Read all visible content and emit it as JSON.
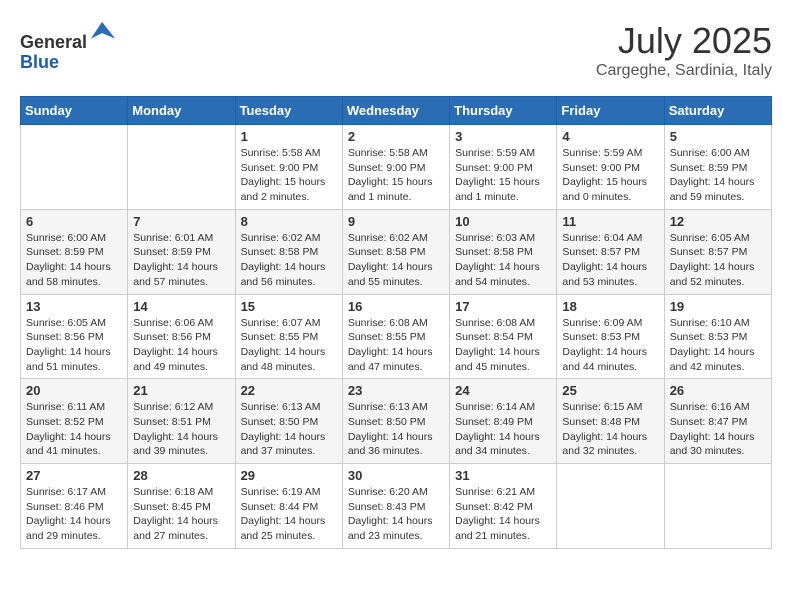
{
  "header": {
    "logo_general": "General",
    "logo_blue": "Blue",
    "month": "July 2025",
    "location": "Cargeghe, Sardinia, Italy"
  },
  "weekdays": [
    "Sunday",
    "Monday",
    "Tuesday",
    "Wednesday",
    "Thursday",
    "Friday",
    "Saturday"
  ],
  "weeks": [
    [
      {
        "day": "",
        "info": ""
      },
      {
        "day": "",
        "info": ""
      },
      {
        "day": "1",
        "info": "Sunrise: 5:58 AM\nSunset: 9:00 PM\nDaylight: 15 hours\nand 2 minutes."
      },
      {
        "day": "2",
        "info": "Sunrise: 5:58 AM\nSunset: 9:00 PM\nDaylight: 15 hours\nand 1 minute."
      },
      {
        "day": "3",
        "info": "Sunrise: 5:59 AM\nSunset: 9:00 PM\nDaylight: 15 hours\nand 1 minute."
      },
      {
        "day": "4",
        "info": "Sunrise: 5:59 AM\nSunset: 9:00 PM\nDaylight: 15 hours\nand 0 minutes."
      },
      {
        "day": "5",
        "info": "Sunrise: 6:00 AM\nSunset: 8:59 PM\nDaylight: 14 hours\nand 59 minutes."
      }
    ],
    [
      {
        "day": "6",
        "info": "Sunrise: 6:00 AM\nSunset: 8:59 PM\nDaylight: 14 hours\nand 58 minutes."
      },
      {
        "day": "7",
        "info": "Sunrise: 6:01 AM\nSunset: 8:59 PM\nDaylight: 14 hours\nand 57 minutes."
      },
      {
        "day": "8",
        "info": "Sunrise: 6:02 AM\nSunset: 8:58 PM\nDaylight: 14 hours\nand 56 minutes."
      },
      {
        "day": "9",
        "info": "Sunrise: 6:02 AM\nSunset: 8:58 PM\nDaylight: 14 hours\nand 55 minutes."
      },
      {
        "day": "10",
        "info": "Sunrise: 6:03 AM\nSunset: 8:58 PM\nDaylight: 14 hours\nand 54 minutes."
      },
      {
        "day": "11",
        "info": "Sunrise: 6:04 AM\nSunset: 8:57 PM\nDaylight: 14 hours\nand 53 minutes."
      },
      {
        "day": "12",
        "info": "Sunrise: 6:05 AM\nSunset: 8:57 PM\nDaylight: 14 hours\nand 52 minutes."
      }
    ],
    [
      {
        "day": "13",
        "info": "Sunrise: 6:05 AM\nSunset: 8:56 PM\nDaylight: 14 hours\nand 51 minutes."
      },
      {
        "day": "14",
        "info": "Sunrise: 6:06 AM\nSunset: 8:56 PM\nDaylight: 14 hours\nand 49 minutes."
      },
      {
        "day": "15",
        "info": "Sunrise: 6:07 AM\nSunset: 8:55 PM\nDaylight: 14 hours\nand 48 minutes."
      },
      {
        "day": "16",
        "info": "Sunrise: 6:08 AM\nSunset: 8:55 PM\nDaylight: 14 hours\nand 47 minutes."
      },
      {
        "day": "17",
        "info": "Sunrise: 6:08 AM\nSunset: 8:54 PM\nDaylight: 14 hours\nand 45 minutes."
      },
      {
        "day": "18",
        "info": "Sunrise: 6:09 AM\nSunset: 8:53 PM\nDaylight: 14 hours\nand 44 minutes."
      },
      {
        "day": "19",
        "info": "Sunrise: 6:10 AM\nSunset: 8:53 PM\nDaylight: 14 hours\nand 42 minutes."
      }
    ],
    [
      {
        "day": "20",
        "info": "Sunrise: 6:11 AM\nSunset: 8:52 PM\nDaylight: 14 hours\nand 41 minutes."
      },
      {
        "day": "21",
        "info": "Sunrise: 6:12 AM\nSunset: 8:51 PM\nDaylight: 14 hours\nand 39 minutes."
      },
      {
        "day": "22",
        "info": "Sunrise: 6:13 AM\nSunset: 8:50 PM\nDaylight: 14 hours\nand 37 minutes."
      },
      {
        "day": "23",
        "info": "Sunrise: 6:13 AM\nSunset: 8:50 PM\nDaylight: 14 hours\nand 36 minutes."
      },
      {
        "day": "24",
        "info": "Sunrise: 6:14 AM\nSunset: 8:49 PM\nDaylight: 14 hours\nand 34 minutes."
      },
      {
        "day": "25",
        "info": "Sunrise: 6:15 AM\nSunset: 8:48 PM\nDaylight: 14 hours\nand 32 minutes."
      },
      {
        "day": "26",
        "info": "Sunrise: 6:16 AM\nSunset: 8:47 PM\nDaylight: 14 hours\nand 30 minutes."
      }
    ],
    [
      {
        "day": "27",
        "info": "Sunrise: 6:17 AM\nSunset: 8:46 PM\nDaylight: 14 hours\nand 29 minutes."
      },
      {
        "day": "28",
        "info": "Sunrise: 6:18 AM\nSunset: 8:45 PM\nDaylight: 14 hours\nand 27 minutes."
      },
      {
        "day": "29",
        "info": "Sunrise: 6:19 AM\nSunset: 8:44 PM\nDaylight: 14 hours\nand 25 minutes."
      },
      {
        "day": "30",
        "info": "Sunrise: 6:20 AM\nSunset: 8:43 PM\nDaylight: 14 hours\nand 23 minutes."
      },
      {
        "day": "31",
        "info": "Sunrise: 6:21 AM\nSunset: 8:42 PM\nDaylight: 14 hours\nand 21 minutes."
      },
      {
        "day": "",
        "info": ""
      },
      {
        "day": "",
        "info": ""
      }
    ]
  ]
}
